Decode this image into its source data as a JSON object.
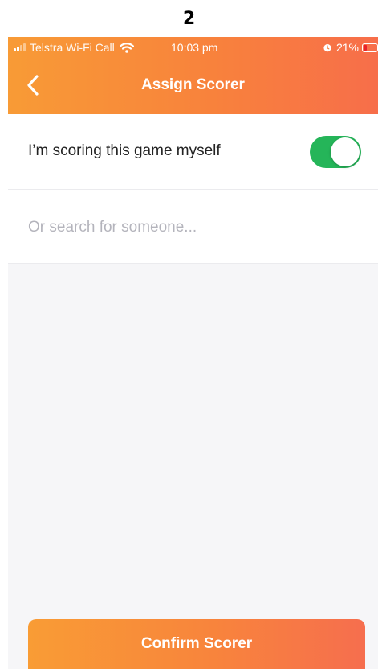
{
  "page_number": "2",
  "status_bar": {
    "carrier": "Telstra Wi-Fi Call",
    "time": "10:03 pm",
    "battery_percent": "21%",
    "icons": [
      "signal-icon",
      "wifi-icon",
      "alarm-icon",
      "battery-icon"
    ]
  },
  "nav": {
    "title": "Assign Scorer",
    "back_icon": "chevron-left-icon"
  },
  "self_scoring": {
    "label": "I’m scoring this game myself",
    "enabled": true
  },
  "search": {
    "value": "",
    "placeholder": "Or search for someone..."
  },
  "confirm_button": {
    "label": "Confirm Scorer"
  },
  "colors": {
    "header_gradient_start": "#f89b36",
    "header_gradient_end": "#f76e4a",
    "toggle_on": "#25b559",
    "placeholder": "#b4b4bc",
    "content_background": "#f6f6f8"
  }
}
